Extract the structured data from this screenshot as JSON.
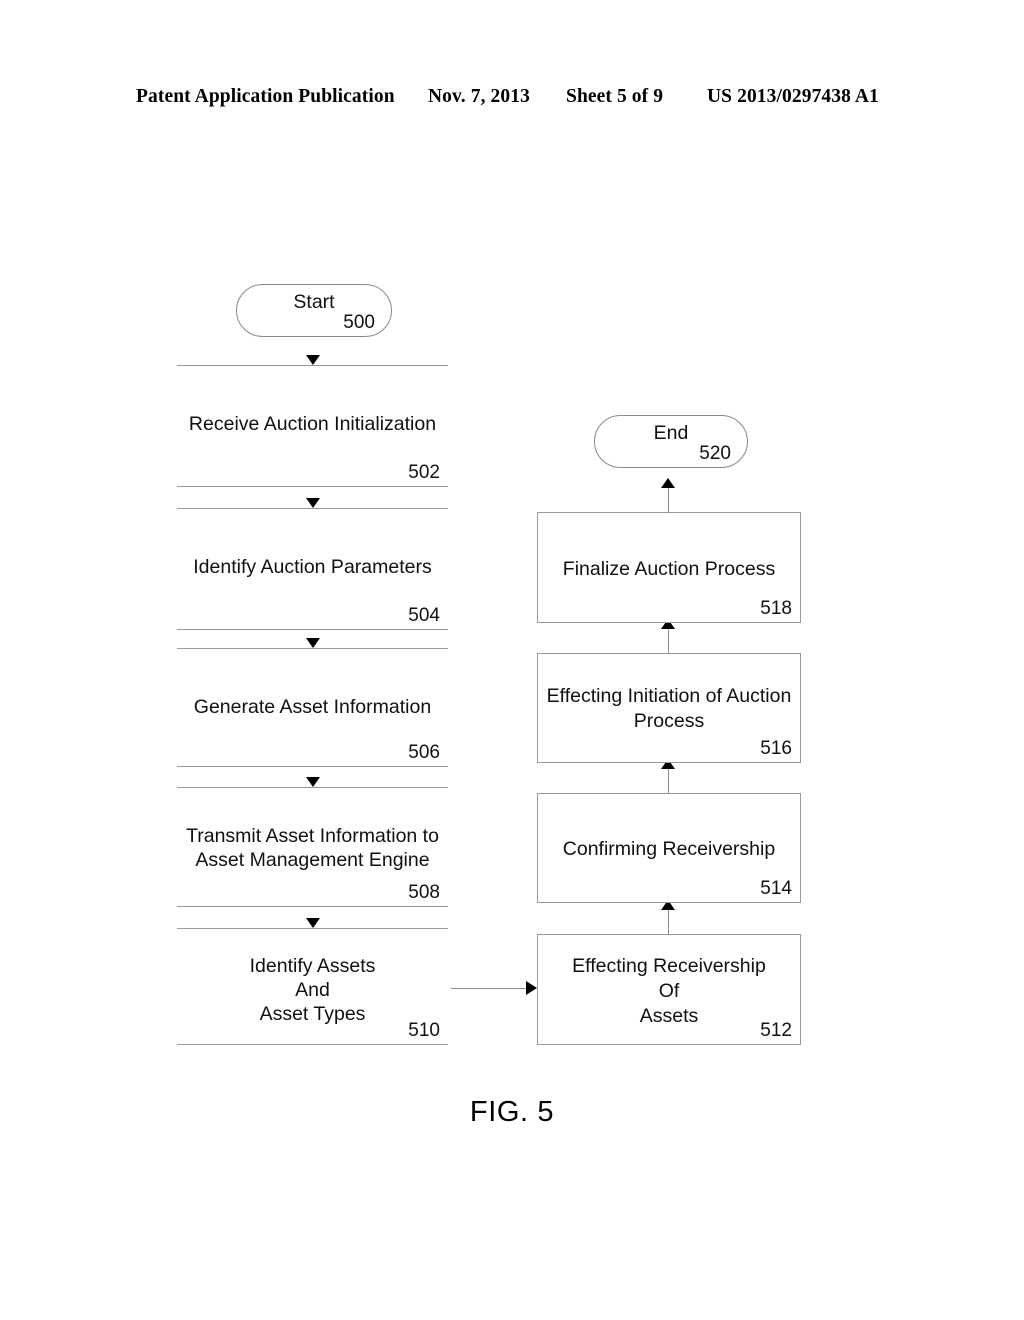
{
  "header": {
    "publication": "Patent Application Publication",
    "date": "Nov. 7, 2013",
    "sheet": "Sheet 5 of 9",
    "patent_number": "US 2013/0297438 A1"
  },
  "figure": {
    "caption": "FIG. 5",
    "line_color": "#9a9a9a",
    "arrow_color": "#000000",
    "text_color": "#111111"
  },
  "flowchart": {
    "start": {
      "label": "Start",
      "ref": "500"
    },
    "end": {
      "label": "End",
      "ref": "520"
    },
    "left_column": [
      {
        "label": "Receive Auction Initialization",
        "ref": "502"
      },
      {
        "label": "Identify Auction Parameters",
        "ref": "504"
      },
      {
        "label": "Generate Asset Information",
        "ref": "506"
      },
      {
        "label": "Transmit Asset Information to\nAsset Management Engine",
        "ref": "508"
      },
      {
        "label": "Identify Assets\nAnd\nAsset Types",
        "ref": "510"
      }
    ],
    "right_column": [
      {
        "label": "Effecting Receivership\nOf\nAssets",
        "ref": "512"
      },
      {
        "label": "Confirming Receivership",
        "ref": "514"
      },
      {
        "label": "Effecting Initiation of Auction\nProcess",
        "ref": "516"
      },
      {
        "label": "Finalize Auction Process",
        "ref": "518"
      }
    ]
  }
}
